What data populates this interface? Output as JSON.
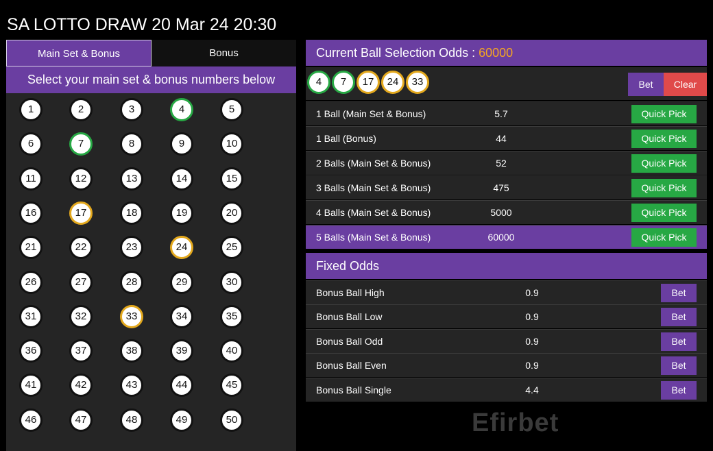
{
  "title": "SA LOTTO DRAW 20 Mar 24 20:30",
  "tabs": [
    {
      "label": "Main Set & Bonus",
      "active": true
    },
    {
      "label": "Bonus",
      "active": false
    }
  ],
  "banner": "Select your main set & bonus numbers below",
  "balls": [
    "1",
    "2",
    "3",
    "4",
    "5",
    "6",
    "7",
    "8",
    "9",
    "10",
    "11",
    "12",
    "13",
    "14",
    "15",
    "16",
    "17",
    "18",
    "19",
    "20",
    "21",
    "22",
    "23",
    "24",
    "25",
    "26",
    "27",
    "28",
    "29",
    "30",
    "31",
    "32",
    "33",
    "34",
    "35",
    "36",
    "37",
    "38",
    "39",
    "40",
    "41",
    "42",
    "43",
    "44",
    "45",
    "46",
    "47",
    "48",
    "49",
    "50"
  ],
  "selected_main": [
    "4",
    "7"
  ],
  "selected_bonus": [
    "17",
    "24",
    "33"
  ],
  "colors": {
    "accent": "#6a3ea1",
    "green": "#27a844",
    "gold": "#e3a81d",
    "clear": "#e04a4a",
    "odds_value": "#f5a623"
  },
  "odds_header": {
    "label": "Current Ball Selection Odds :",
    "value": "60000"
  },
  "selection": [
    {
      "num": "4",
      "type": "main"
    },
    {
      "num": "7",
      "type": "main"
    },
    {
      "num": "17",
      "type": "bonus"
    },
    {
      "num": "24",
      "type": "bonus"
    },
    {
      "num": "33",
      "type": "bonus"
    }
  ],
  "bet_label": "Bet",
  "clear_label": "Clear",
  "odds_rows": [
    {
      "label": "1 Ball (Main Set & Bonus)",
      "odds": "5.7",
      "button": "Quick Pick"
    },
    {
      "label": "1 Ball (Bonus)",
      "odds": "44",
      "button": "Quick Pick"
    },
    {
      "label": "2 Balls (Main Set & Bonus)",
      "odds": "52",
      "button": "Quick Pick"
    },
    {
      "label": "3 Balls (Main Set & Bonus)",
      "odds": "475",
      "button": "Quick Pick"
    },
    {
      "label": "4 Balls (Main Set & Bonus)",
      "odds": "5000",
      "button": "Quick Pick"
    },
    {
      "label": "5 Balls (Main Set & Bonus)",
      "odds": "60000",
      "button": "Quick Pick",
      "highlight": true
    }
  ],
  "fixed_header": "Fixed Odds",
  "fixed_rows": [
    {
      "label": "Bonus Ball High",
      "odds": "0.9",
      "button": "Bet"
    },
    {
      "label": "Bonus Ball Low",
      "odds": "0.9",
      "button": "Bet"
    },
    {
      "label": "Bonus Ball Odd",
      "odds": "0.9",
      "button": "Bet"
    },
    {
      "label": "Bonus Ball Even",
      "odds": "0.9",
      "button": "Bet"
    },
    {
      "label": "Bonus Ball Single",
      "odds": "4.4",
      "button": "Bet"
    }
  ],
  "watermark": "Efirbet"
}
